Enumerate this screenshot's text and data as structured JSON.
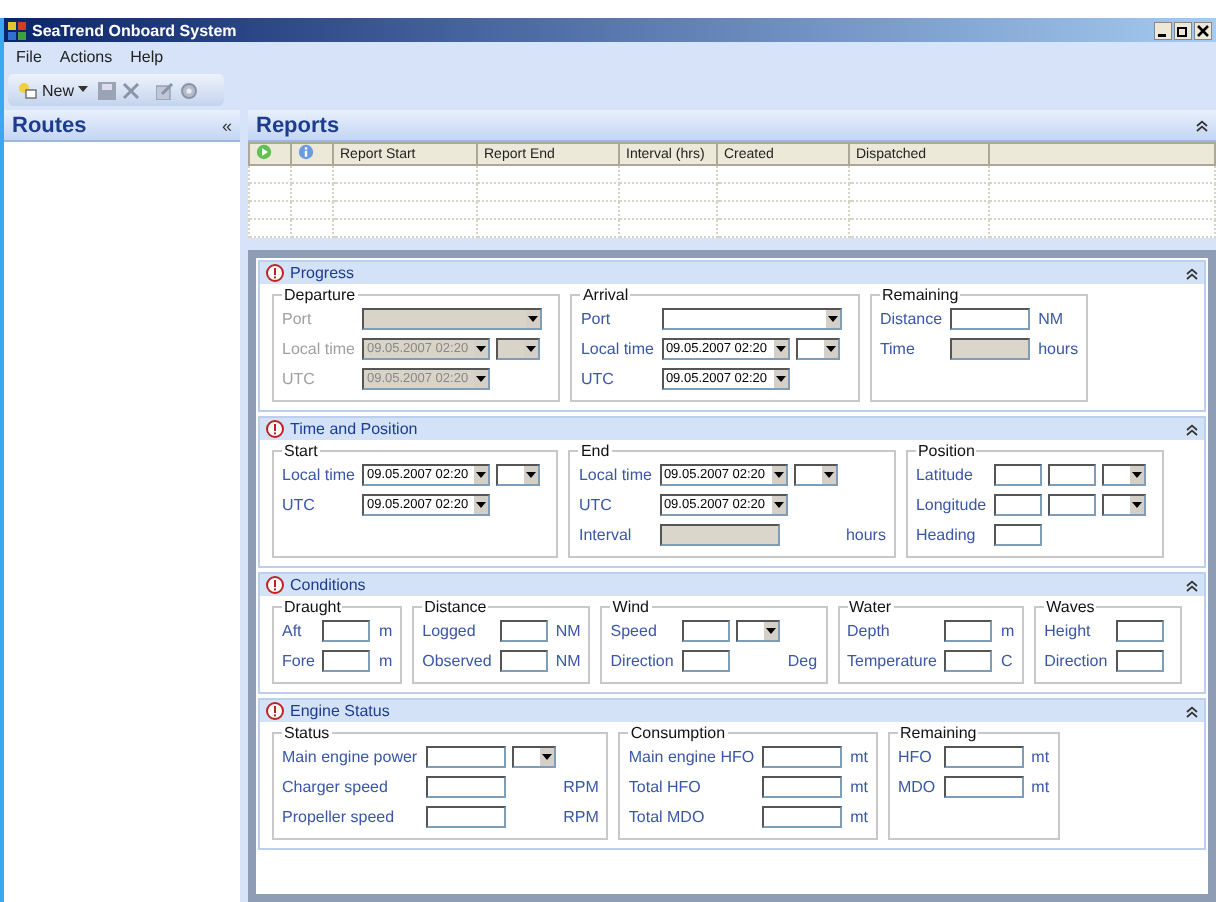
{
  "window": {
    "title": "SeaTrend Onboard System"
  },
  "menu": [
    "File",
    "Actions",
    "Help"
  ],
  "toolbar": {
    "new_label": "New"
  },
  "routes": {
    "title": "Routes",
    "collapse": "«"
  },
  "reports": {
    "title": "Reports",
    "columns": [
      "Report Start",
      "Report End",
      "Interval (hrs)",
      "Created",
      "Dispatched"
    ]
  },
  "sections": [
    {
      "title": "Progress",
      "groups": [
        {
          "title": "Departure",
          "disabled": true,
          "rows": [
            {
              "label": "Port",
              "fields": [
                {
                  "kind": "port"
                }
              ]
            },
            {
              "label": "Local time",
              "fields": [
                {
                  "kind": "date",
                  "value": "09.05.2007 02:20"
                },
                {
                  "kind": "combo"
                }
              ]
            },
            {
              "label": "UTC",
              "fields": [
                {
                  "kind": "date",
                  "value": "09.05.2007 02:20"
                }
              ]
            }
          ]
        },
        {
          "title": "Arrival",
          "disabled": false,
          "rows": [
            {
              "label": "Port",
              "fields": [
                {
                  "kind": "port"
                }
              ]
            },
            {
              "label": "Local time",
              "fields": [
                {
                  "kind": "date",
                  "value": "09.05.2007 02:20"
                },
                {
                  "kind": "combo"
                }
              ]
            },
            {
              "label": "UTC",
              "fields": [
                {
                  "kind": "date",
                  "value": "09.05.2007 02:20"
                }
              ]
            }
          ]
        },
        {
          "title": "Remaining",
          "disabled": false,
          "rows": [
            {
              "label": "Distance",
              "fields": [
                {
                  "kind": "text"
                }
              ],
              "unit": "NM"
            },
            {
              "label": "Time",
              "fields": [
                {
                  "kind": "shaded"
                }
              ],
              "unit": "hours"
            }
          ]
        }
      ]
    },
    {
      "title": "Time and Position",
      "groups": [
        {
          "title": "Start",
          "disabled": false,
          "rows": [
            {
              "label": "Local time",
              "fields": [
                {
                  "kind": "date",
                  "value": "09.05.2007 02:20"
                },
                {
                  "kind": "combo"
                }
              ]
            },
            {
              "label": "UTC",
              "fields": [
                {
                  "kind": "date",
                  "value": "09.05.2007 02:20"
                }
              ]
            }
          ]
        },
        {
          "title": "End",
          "disabled": false,
          "rows": [
            {
              "label": "Local time",
              "fields": [
                {
                  "kind": "date",
                  "value": "09.05.2007 02:20"
                },
                {
                  "kind": "combo"
                }
              ]
            },
            {
              "label": "UTC",
              "fields": [
                {
                  "kind": "date",
                  "value": "09.05.2007 02:20"
                }
              ]
            },
            {
              "label": "Interval",
              "fields": [
                {
                  "kind": "shaded-wide"
                }
              ],
              "unit": "hours"
            }
          ]
        },
        {
          "title": "Position",
          "disabled": false,
          "rows": [
            {
              "label": "Latitude",
              "fields": [
                {
                  "kind": "short"
                },
                {
                  "kind": "short"
                },
                {
                  "kind": "combo"
                }
              ]
            },
            {
              "label": "Longitude",
              "fields": [
                {
                  "kind": "short"
                },
                {
                  "kind": "short"
                },
                {
                  "kind": "combo"
                }
              ]
            },
            {
              "label": "Heading",
              "fields": [
                {
                  "kind": "short"
                }
              ]
            }
          ]
        }
      ]
    },
    {
      "title": "Conditions",
      "groups": [
        {
          "title": "Draught",
          "disabled": false,
          "rows": [
            {
              "label": "Aft",
              "fields": [
                {
                  "kind": "short"
                }
              ],
              "unit": "m"
            },
            {
              "label": "Fore",
              "fields": [
                {
                  "kind": "short"
                }
              ],
              "unit": "m"
            }
          ]
        },
        {
          "title": "Distance",
          "disabled": false,
          "rows": [
            {
              "label": "Logged",
              "fields": [
                {
                  "kind": "short"
                }
              ],
              "unit": "NM"
            },
            {
              "label": "Observed",
              "fields": [
                {
                  "kind": "short"
                }
              ],
              "unit": "NM"
            }
          ]
        },
        {
          "title": "Wind",
          "disabled": false,
          "rows": [
            {
              "label": "Speed",
              "fields": [
                {
                  "kind": "short"
                },
                {
                  "kind": "combo"
                }
              ]
            },
            {
              "label": "Direction",
              "fields": [
                {
                  "kind": "short"
                }
              ],
              "unit": "Deg"
            }
          ]
        },
        {
          "title": "Water",
          "disabled": false,
          "rows": [
            {
              "label": "Depth",
              "fields": [
                {
                  "kind": "short"
                }
              ],
              "unit": "m"
            },
            {
              "label": "Temperature",
              "fields": [
                {
                  "kind": "short"
                }
              ],
              "unit": "C"
            }
          ]
        },
        {
          "title": "Waves",
          "disabled": false,
          "rows": [
            {
              "label": "Height",
              "fields": [
                {
                  "kind": "short"
                }
              ]
            },
            {
              "label": "Direction",
              "fields": [
                {
                  "kind": "short"
                }
              ]
            }
          ]
        }
      ]
    },
    {
      "title": "Engine Status",
      "groups": [
        {
          "title": "Status",
          "disabled": false,
          "rows": [
            {
              "label": "Main engine power",
              "fields": [
                {
                  "kind": "text"
                },
                {
                  "kind": "combo"
                }
              ]
            },
            {
              "label": "Charger speed",
              "fields": [
                {
                  "kind": "text"
                }
              ],
              "unit": "RPM"
            },
            {
              "label": "Propeller speed",
              "fields": [
                {
                  "kind": "text"
                }
              ],
              "unit": "RPM"
            }
          ]
        },
        {
          "title": "Consumption",
          "disabled": false,
          "rows": [
            {
              "label": "Main engine HFO",
              "fields": [
                {
                  "kind": "text"
                }
              ],
              "unit": "mt"
            },
            {
              "label": "Total HFO",
              "fields": [
                {
                  "kind": "text"
                }
              ],
              "unit": "mt"
            },
            {
              "label": "Total MDO",
              "fields": [
                {
                  "kind": "text"
                }
              ],
              "unit": "mt"
            }
          ]
        },
        {
          "title": "Remaining",
          "disabled": false,
          "rows": [
            {
              "label": "HFO",
              "fields": [
                {
                  "kind": "text"
                }
              ],
              "unit": "mt"
            },
            {
              "label": "MDO",
              "fields": [
                {
                  "kind": "text"
                }
              ],
              "unit": "mt"
            }
          ]
        }
      ]
    }
  ]
}
